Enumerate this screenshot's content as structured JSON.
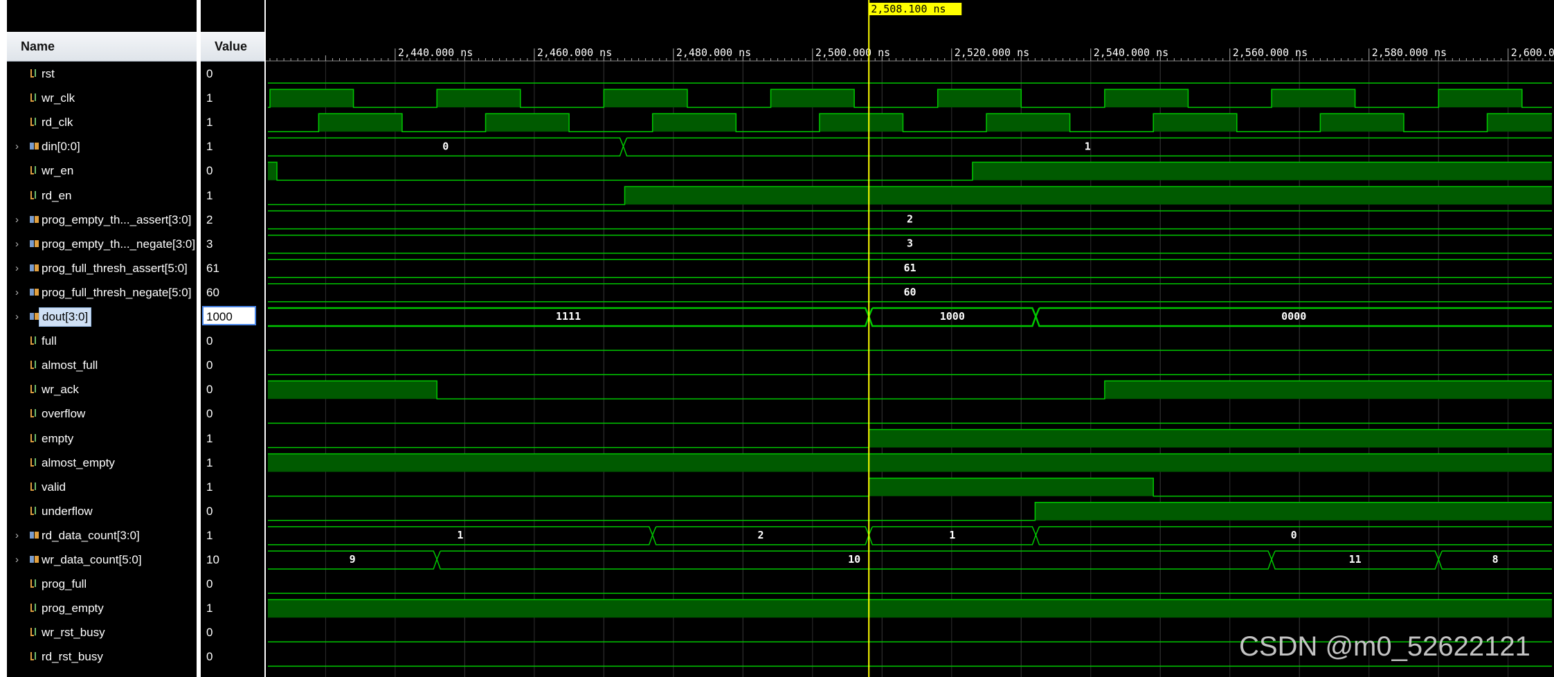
{
  "columns": {
    "name": "Name",
    "value": "Value"
  },
  "cursor": {
    "label": "2,508.100 ns",
    "time": 2508.1
  },
  "timeline": {
    "start": 2421.7,
    "end": 2606.3,
    "tick_labels": [
      "2,440.000 ns",
      "2,460.000 ns",
      "2,480.000 ns",
      "2,500.000 ns",
      "2,520.000 ns",
      "2,540.000 ns",
      "2,560.000 ns",
      "2,580.000 ns",
      "2,600.000 ns"
    ],
    "tick_times": [
      2440,
      2460,
      2480,
      2500,
      2520,
      2540,
      2560,
      2580,
      2600
    ]
  },
  "signals": [
    {
      "name": "rst",
      "value": "0",
      "kind": "bit",
      "expandable": false,
      "wave": {
        "high": []
      }
    },
    {
      "name": "wr_clk",
      "value": "1",
      "kind": "bit",
      "expandable": false,
      "wave": {
        "high": [
          [
            2422,
            2434
          ],
          [
            2446,
            2458
          ],
          [
            2470,
            2482
          ],
          [
            2494,
            2506
          ],
          [
            2518,
            2530
          ],
          [
            2542,
            2554
          ],
          [
            2566,
            2578
          ],
          [
            2590,
            2602
          ]
        ]
      }
    },
    {
      "name": "rd_clk",
      "value": "1",
      "kind": "bit",
      "expandable": false,
      "wave": {
        "high": [
          [
            2429,
            2441
          ],
          [
            2453,
            2465
          ],
          [
            2477,
            2489
          ],
          [
            2501,
            2513
          ],
          [
            2525,
            2537
          ],
          [
            2549,
            2561
          ],
          [
            2573,
            2585
          ],
          [
            2597,
            2606.3
          ]
        ]
      }
    },
    {
      "name": "din[0:0]",
      "value": "1",
      "kind": "bus",
      "expandable": true,
      "wave": {
        "segments": [
          [
            2421.7,
            2472.8,
            "0"
          ],
          [
            2472.8,
            2606.3,
            "1"
          ]
        ]
      }
    },
    {
      "name": "wr_en",
      "value": "0",
      "kind": "bit",
      "expandable": false,
      "wave": {
        "high": [
          [
            2421.7,
            2423
          ],
          [
            2523,
            2606.3
          ]
        ]
      }
    },
    {
      "name": "rd_en",
      "value": "1",
      "kind": "bit",
      "expandable": false,
      "wave": {
        "high": [
          [
            2473,
            2606.3
          ]
        ]
      }
    },
    {
      "name": "prog_empty_th..._assert[3:0]",
      "value": "2",
      "kind": "bus",
      "expandable": true,
      "wave": {
        "segments": [
          [
            2421.7,
            2606.3,
            "2"
          ]
        ]
      }
    },
    {
      "name": "prog_empty_th..._negate[3:0]",
      "value": "3",
      "kind": "bus",
      "expandable": true,
      "wave": {
        "segments": [
          [
            2421.7,
            2606.3,
            "3"
          ]
        ]
      }
    },
    {
      "name": "prog_full_thresh_assert[5:0]",
      "value": "61",
      "kind": "bus",
      "expandable": true,
      "wave": {
        "segments": [
          [
            2421.7,
            2606.3,
            "61"
          ]
        ]
      }
    },
    {
      "name": "prog_full_thresh_negate[5:0]",
      "value": "60",
      "kind": "bus",
      "expandable": true,
      "wave": {
        "segments": [
          [
            2421.7,
            2606.3,
            "60"
          ]
        ]
      }
    },
    {
      "name": "dout[3:0]",
      "value": "1000",
      "kind": "bus",
      "expandable": true,
      "selected": true,
      "wave": {
        "segments": [
          [
            2421.7,
            2508.1,
            "1111"
          ],
          [
            2508.1,
            2532.1,
            "1000"
          ],
          [
            2532.1,
            2606.3,
            "0000"
          ]
        ]
      }
    },
    {
      "name": "full",
      "value": "0",
      "kind": "bit",
      "expandable": false,
      "wave": {
        "high": []
      }
    },
    {
      "name": "almost_full",
      "value": "0",
      "kind": "bit",
      "expandable": false,
      "wave": {
        "high": []
      }
    },
    {
      "name": "wr_ack",
      "value": "0",
      "kind": "bit",
      "expandable": false,
      "wave": {
        "high": [
          [
            2421.7,
            2446
          ],
          [
            2542,
            2606.3
          ]
        ]
      }
    },
    {
      "name": "overflow",
      "value": "0",
      "kind": "bit",
      "expandable": false,
      "wave": {
        "high": []
      }
    },
    {
      "name": "empty",
      "value": "1",
      "kind": "bit",
      "expandable": false,
      "wave": {
        "high": [
          [
            2508.1,
            2606.3
          ]
        ]
      }
    },
    {
      "name": "almost_empty",
      "value": "1",
      "kind": "bit",
      "expandable": false,
      "wave": {
        "high": [
          [
            2421.7,
            2606.3
          ]
        ]
      }
    },
    {
      "name": "valid",
      "value": "1",
      "kind": "bit",
      "expandable": false,
      "wave": {
        "high": [
          [
            2508.1,
            2549
          ]
        ]
      }
    },
    {
      "name": "underflow",
      "value": "0",
      "kind": "bit",
      "expandable": false,
      "wave": {
        "high": [
          [
            2532,
            2606.3
          ]
        ]
      }
    },
    {
      "name": "rd_data_count[3:0]",
      "value": "1",
      "kind": "bus",
      "expandable": true,
      "wave": {
        "segments": [
          [
            2421.7,
            2477,
            "1"
          ],
          [
            2477,
            2508.1,
            "2"
          ],
          [
            2508.1,
            2532.1,
            "1"
          ],
          [
            2532.1,
            2606.3,
            "0"
          ]
        ]
      }
    },
    {
      "name": "wr_data_count[5:0]",
      "value": "10",
      "kind": "bus",
      "expandable": true,
      "wave": {
        "segments": [
          [
            2421.7,
            2446,
            "9"
          ],
          [
            2446,
            2566,
            "10"
          ],
          [
            2566,
            2590,
            "11"
          ],
          [
            2590,
            2606.3,
            "8"
          ]
        ]
      }
    },
    {
      "name": "prog_full",
      "value": "0",
      "kind": "bit",
      "expandable": false,
      "wave": {
        "high": []
      }
    },
    {
      "name": "prog_empty",
      "value": "1",
      "kind": "bit",
      "expandable": false,
      "wave": {
        "high": [
          [
            2421.7,
            2606.3
          ]
        ]
      }
    },
    {
      "name": "wr_rst_busy",
      "value": "0",
      "kind": "bit",
      "expandable": false,
      "wave": {
        "high": []
      }
    },
    {
      "name": "rd_rst_busy",
      "value": "0",
      "kind": "bit",
      "expandable": false,
      "wave": {
        "high": []
      }
    }
  ],
  "watermark": "CSDN @m0_52622121",
  "colors": {
    "wave": "#00c800",
    "fill": "#005a00",
    "cursor": "#ffff00",
    "grid": "#2a4a2a",
    "bus_text": "#ffffff",
    "tick": "#ffffff"
  }
}
